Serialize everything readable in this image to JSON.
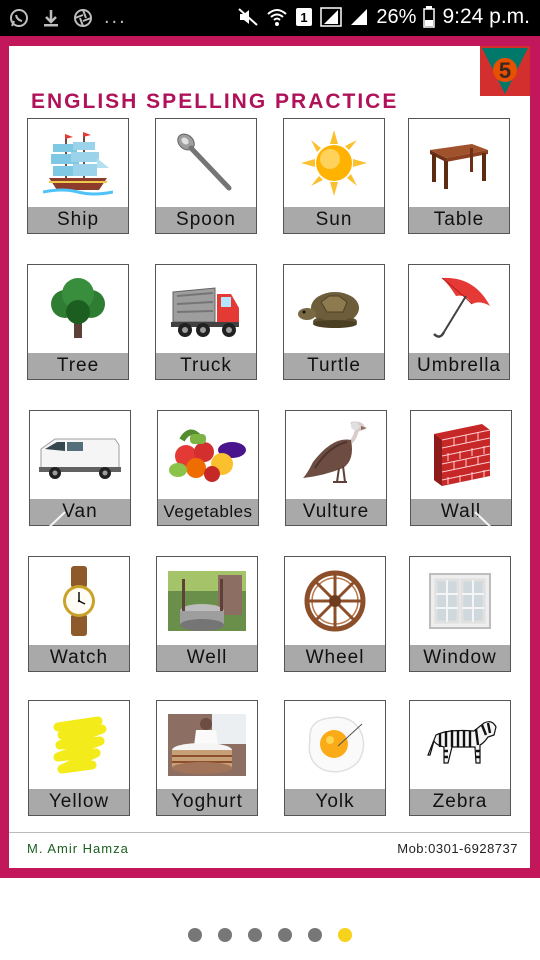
{
  "status_bar": {
    "left_icons": [
      "whatsapp-icon",
      "download-icon",
      "camera-aperture-icon"
    ],
    "overflow": "...",
    "battery_percent": "26%",
    "time": "9:24 p.m.",
    "sim_label": "1"
  },
  "page": {
    "title": "ENGLISH SPELLING PRACTICE",
    "badge_number": "5",
    "colors": {
      "frame": "#c2185b",
      "title": "#b0125a",
      "label_bg": "#a9a9a9",
      "badge_bg": "#d32f2f",
      "badge_triangle": "#00796b",
      "badge_circle": "#e65100"
    }
  },
  "items": [
    {
      "label": "Ship",
      "icon": "ship-icon"
    },
    {
      "label": "Spoon",
      "icon": "spoon-icon"
    },
    {
      "label": "Sun",
      "icon": "sun-icon"
    },
    {
      "label": "Table",
      "icon": "table-icon"
    },
    {
      "label": "Tree",
      "icon": "tree-icon"
    },
    {
      "label": "Truck",
      "icon": "truck-icon"
    },
    {
      "label": "Turtle",
      "icon": "turtle-icon"
    },
    {
      "label": "Umbrella",
      "icon": "umbrella-icon"
    },
    {
      "label": "Van",
      "icon": "van-icon"
    },
    {
      "label": "Vegetables",
      "icon": "vegetables-icon"
    },
    {
      "label": "Vulture",
      "icon": "vulture-icon"
    },
    {
      "label": "Wall",
      "icon": "brick-wall-icon"
    },
    {
      "label": "Watch",
      "icon": "watch-icon"
    },
    {
      "label": "Well",
      "icon": "well-icon"
    },
    {
      "label": "Wheel",
      "icon": "wheel-icon"
    },
    {
      "label": "Window",
      "icon": "window-icon"
    },
    {
      "label": "Yellow",
      "icon": "yellow-scribble-icon"
    },
    {
      "label": "Yoghurt",
      "icon": "yoghurt-icon"
    },
    {
      "label": "Yolk",
      "icon": "egg-yolk-icon"
    },
    {
      "label": "Zebra",
      "icon": "zebra-icon"
    }
  ],
  "footer": {
    "author": "M. Amir Hamza",
    "mobile": "Mob:0301-6928737"
  },
  "pager": {
    "count": 6,
    "active_index": 5
  }
}
